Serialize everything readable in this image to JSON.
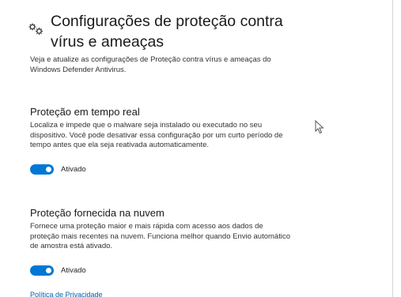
{
  "header": {
    "title": "Configurações de proteção contra vírus e ameaças",
    "icon": "gears-icon"
  },
  "intro": "Veja e atualize as configurações de Proteção contra vírus e ameaças do Windows Defender Antivirus.",
  "realtime": {
    "title": "Proteção em tempo real",
    "description": "Localiza e impede que o malware seja instalado ou executado no seu dispositivo. Você pode desativar essa configuração por um curto período de tempo antes que ela seja reativada automaticamente.",
    "toggle_label": "Ativado",
    "toggle_on": true
  },
  "cloud": {
    "title": "Proteção fornecida na nuvem",
    "description": "Fornece uma proteção maior e mais rápida com acesso aos dados de proteção mais recentes na nuvem. Funciona melhor quando Envio automático de amostra está ativado.",
    "toggle_label": "Ativado",
    "toggle_on": true
  },
  "privacy_link": "Política de Privacidade",
  "colors": {
    "accent": "#0078d4",
    "link": "#0063b1"
  }
}
